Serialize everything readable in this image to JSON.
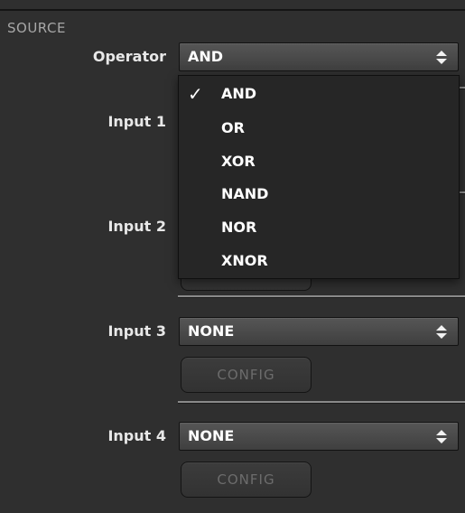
{
  "section": {
    "title": "SOURCE"
  },
  "operator": {
    "label": "Operator",
    "selected": "AND",
    "options": [
      {
        "label": "AND",
        "checked": true
      },
      {
        "label": "OR",
        "checked": false
      },
      {
        "label": "XOR",
        "checked": false
      },
      {
        "label": "NAND",
        "checked": false
      },
      {
        "label": "NOR",
        "checked": false
      },
      {
        "label": "XNOR",
        "checked": false
      }
    ],
    "check_mark": "✓"
  },
  "inputs": [
    {
      "label": "Input 1"
    },
    {
      "label": "Input 2"
    },
    {
      "label": "Input 3",
      "value": "NONE",
      "config_label": "CONFIG"
    },
    {
      "label": "Input 4",
      "value": "NONE",
      "config_label": "CONFIG"
    }
  ]
}
